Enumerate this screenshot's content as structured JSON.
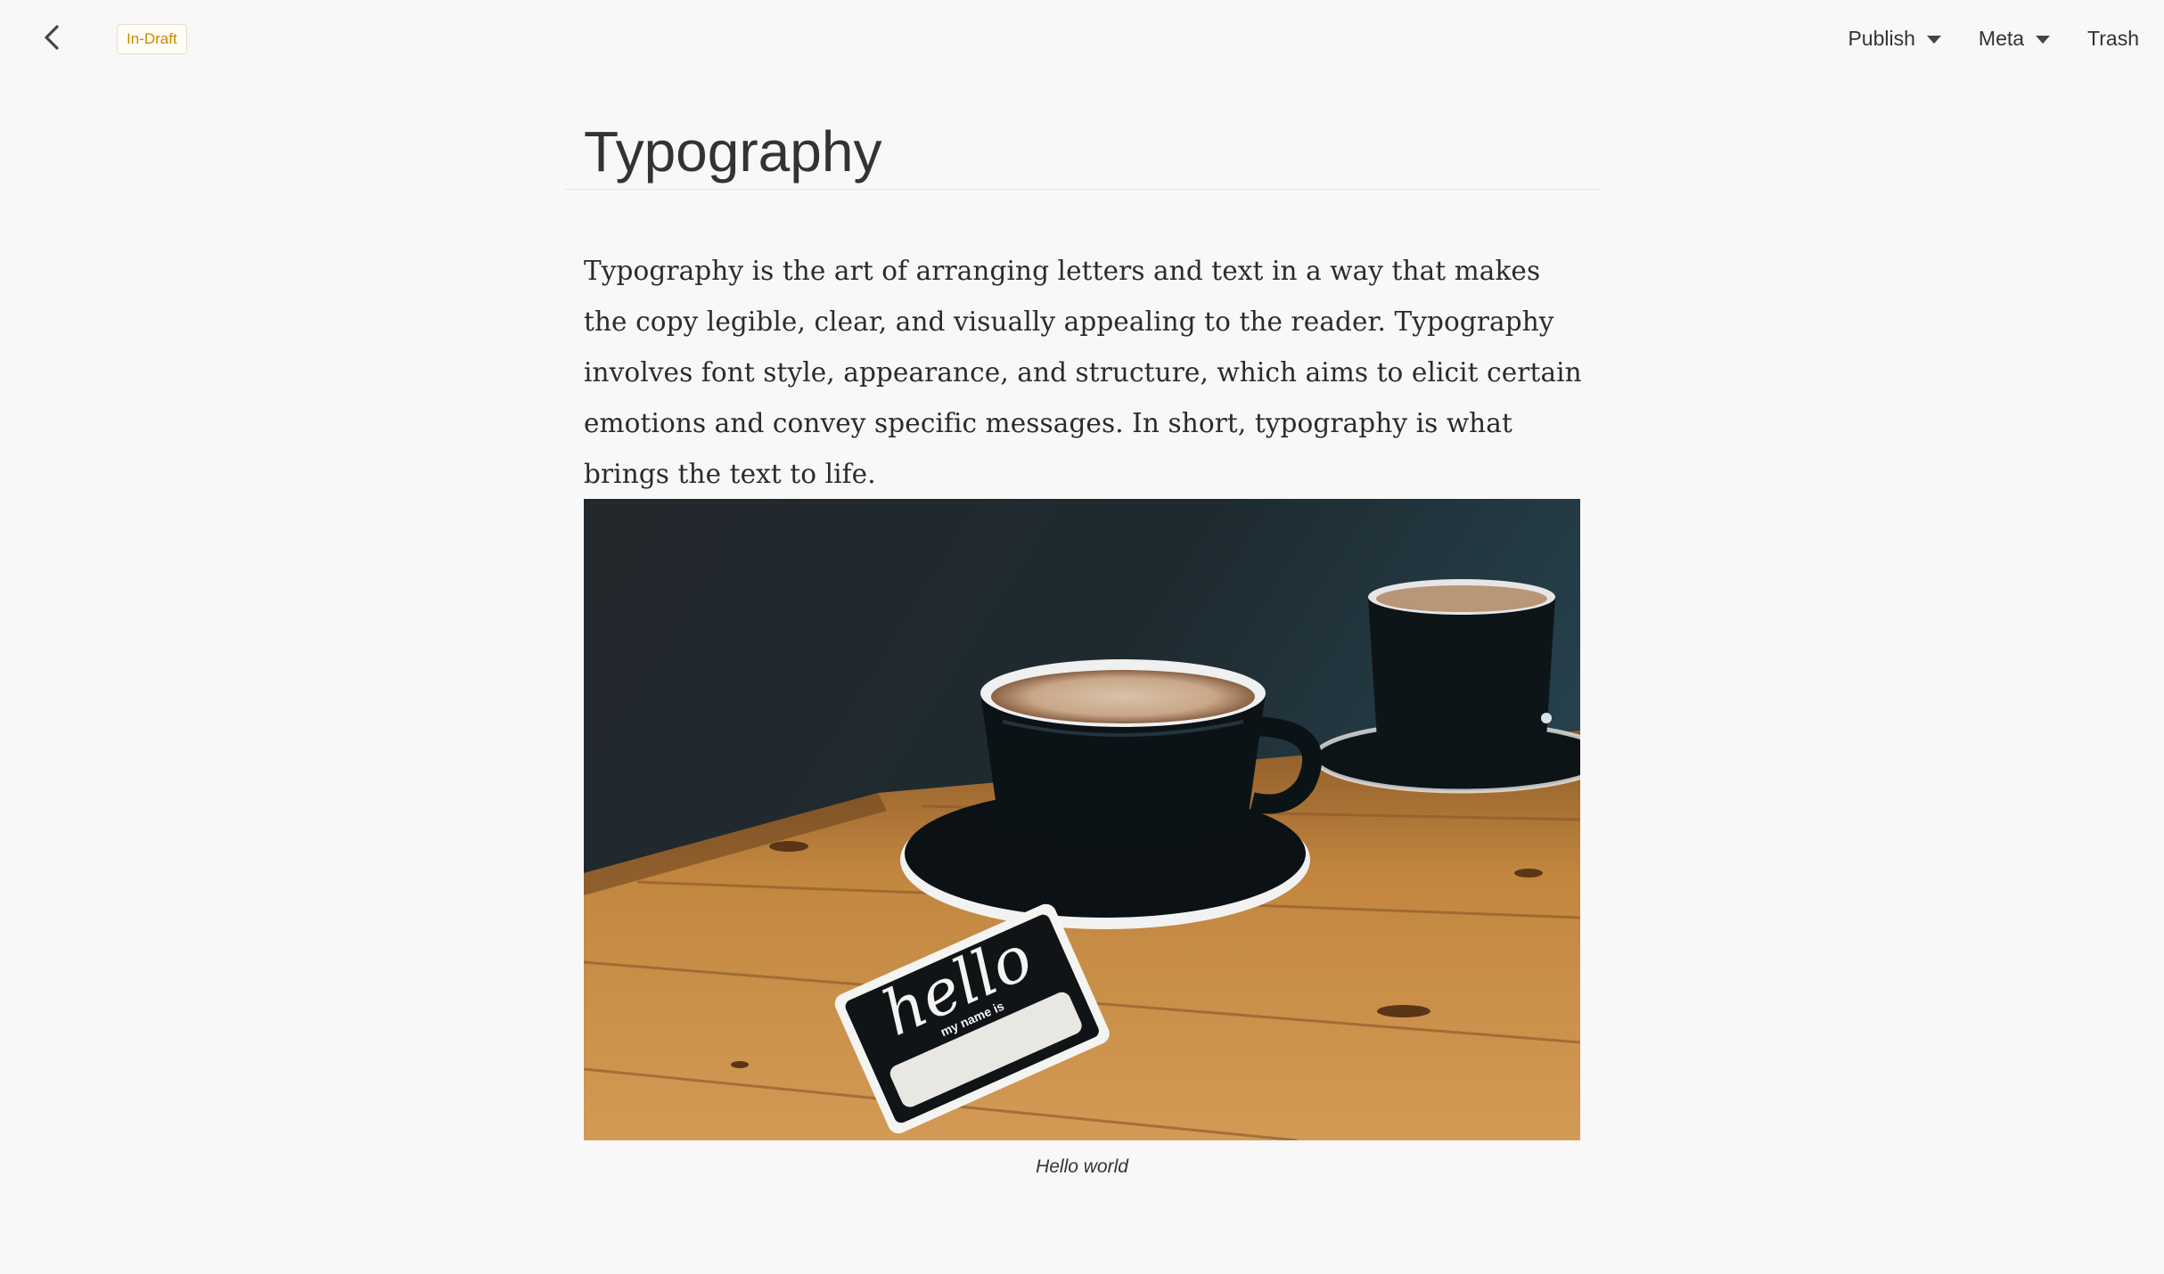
{
  "header": {
    "back_icon": "chevron-left-icon",
    "status_badge": "In-Draft",
    "menu": {
      "publish_label": "Publish",
      "meta_label": "Meta",
      "trash_label": "Trash"
    }
  },
  "post": {
    "title": "Typography",
    "paragraph": "Typography is the art of arranging letters and text in a way that makes the copy legible, clear, and visually appealing to the reader. Typography involves font style, appearance, and structure, which aims to elicit certain emotions and convey specific messages. In short, typography is what brings the text to life.",
    "image": {
      "sticker_text_main": "hello",
      "sticker_text_sub": "my name is"
    },
    "caption": "Hello world"
  },
  "colors": {
    "background": "#f8f8f8",
    "badge_text": "#c78a00",
    "text": "#333333"
  }
}
